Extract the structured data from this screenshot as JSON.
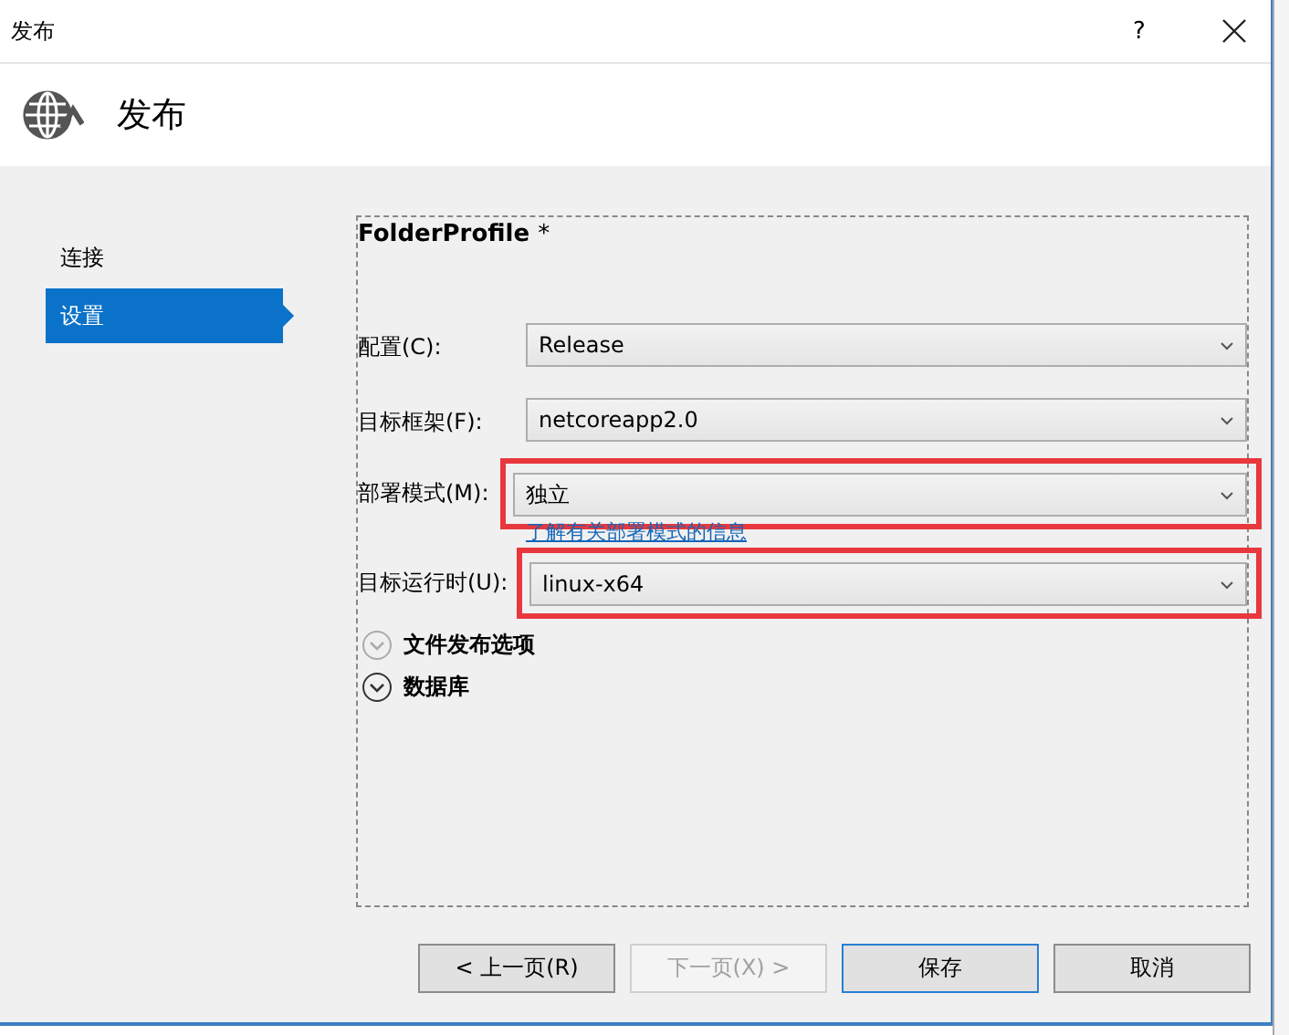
{
  "window": {
    "title": "发布",
    "help": "?"
  },
  "header": {
    "title": "发布"
  },
  "sidebar": {
    "items": [
      {
        "label": "连接",
        "selected": false
      },
      {
        "label": "设置",
        "selected": true
      }
    ]
  },
  "profile": {
    "title": "FolderProfile",
    "modified_mark": "*"
  },
  "fields": [
    {
      "label": "配置(C):",
      "value": "Release",
      "highlighted": false
    },
    {
      "label": "目标框架(F):",
      "value": "netcoreapp2.0",
      "highlighted": false
    },
    {
      "label": "部署模式(M):",
      "value": "独立",
      "highlighted": true,
      "link": "了解有关部署模式的信息"
    },
    {
      "label": "目标运行时(U):",
      "value": "linux-x64",
      "highlighted": true
    }
  ],
  "sections": [
    {
      "label": "文件发布选项",
      "expanded": false,
      "disabled": true
    },
    {
      "label": "数据库",
      "expanded": false,
      "disabled": false
    }
  ],
  "buttons": [
    {
      "label": "< 上一页(R)",
      "disabled": false,
      "default": false
    },
    {
      "label": "下一页(X) >",
      "disabled": true,
      "default": false
    },
    {
      "label": "保存",
      "disabled": false,
      "default": true
    },
    {
      "label": "取消",
      "disabled": false,
      "default": false
    }
  ]
}
